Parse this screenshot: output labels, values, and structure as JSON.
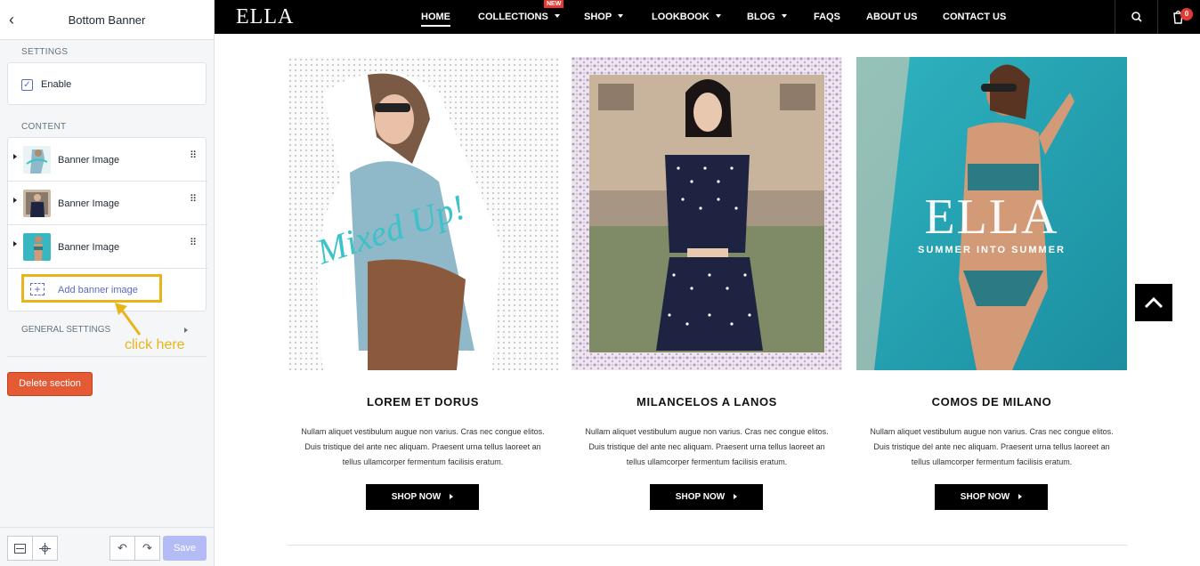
{
  "editor": {
    "title": "Bottom Banner",
    "settings_label": "SETTINGS",
    "enable_label": "Enable",
    "enable_checked": true,
    "content_label": "CONTENT",
    "blocks": [
      {
        "label": "Banner Image",
        "thumb_color": "#8fb8c9"
      },
      {
        "label": "Banner Image",
        "thumb_color": "#6b5d6a"
      },
      {
        "label": "Banner Image",
        "thumb_color": "#3cb9c4"
      }
    ],
    "add_block_label": "Add banner image",
    "general_settings_label": "GENERAL SETTINGS",
    "annotation": "click here",
    "delete_label": "Delete section",
    "save_label": "Save",
    "accent_color": "#5c6ac4",
    "highlight_color": "#e8b41c"
  },
  "store": {
    "logo": "ELLA",
    "menu": [
      {
        "label": "HOME",
        "active": true,
        "dropdown": false
      },
      {
        "label": "COLLECTIONS",
        "active": false,
        "dropdown": true,
        "badge": "NEW"
      },
      {
        "label": "SHOP",
        "active": false,
        "dropdown": true
      },
      {
        "label": "LOOKBOOK",
        "active": false,
        "dropdown": true
      },
      {
        "label": "BLOG",
        "active": false,
        "dropdown": true
      },
      {
        "label": "FAQS",
        "active": false,
        "dropdown": false
      },
      {
        "label": "ABOUT US",
        "active": false,
        "dropdown": false
      },
      {
        "label": "CONTACT US",
        "active": false,
        "dropdown": false
      }
    ],
    "cart_count": "0",
    "products": [
      {
        "title": "LOREM ET DORUS",
        "desc_lines": [
          "Nullam aliquet vestibulum augue non varius. Cras nec congue elitos.",
          "Duis tristique del ante nec aliquam. Praesent urna tellus laoreet an",
          "tellus ullamcorper fermentum facilisis eratum."
        ],
        "button": "SHOP NOW",
        "overlay_text": "Mixed Up!"
      },
      {
        "title": "MILANCELOS A LANOS",
        "desc_lines": [
          "Nullam aliquet vestibulum augue non varius. Cras nec congue elitos.",
          "Duis tristique del ante nec aliquam. Praesent urna tellus laoreet an",
          "tellus ullamcorper fermentum facilisis eratum."
        ],
        "button": "SHOP NOW"
      },
      {
        "title": "COMOS DE MILANO",
        "desc_lines": [
          "Nullam aliquet vestibulum augue non varius. Cras nec congue elitos.",
          "Duis tristique del ante nec aliquam. Praesent urna tellus laoreet an",
          "tellus ullamcorper fermentum facilisis eratum."
        ],
        "button": "SHOP NOW",
        "overlay_title": "ELLA",
        "overlay_subtitle": "SUMMER INTO SUMMER"
      }
    ]
  }
}
